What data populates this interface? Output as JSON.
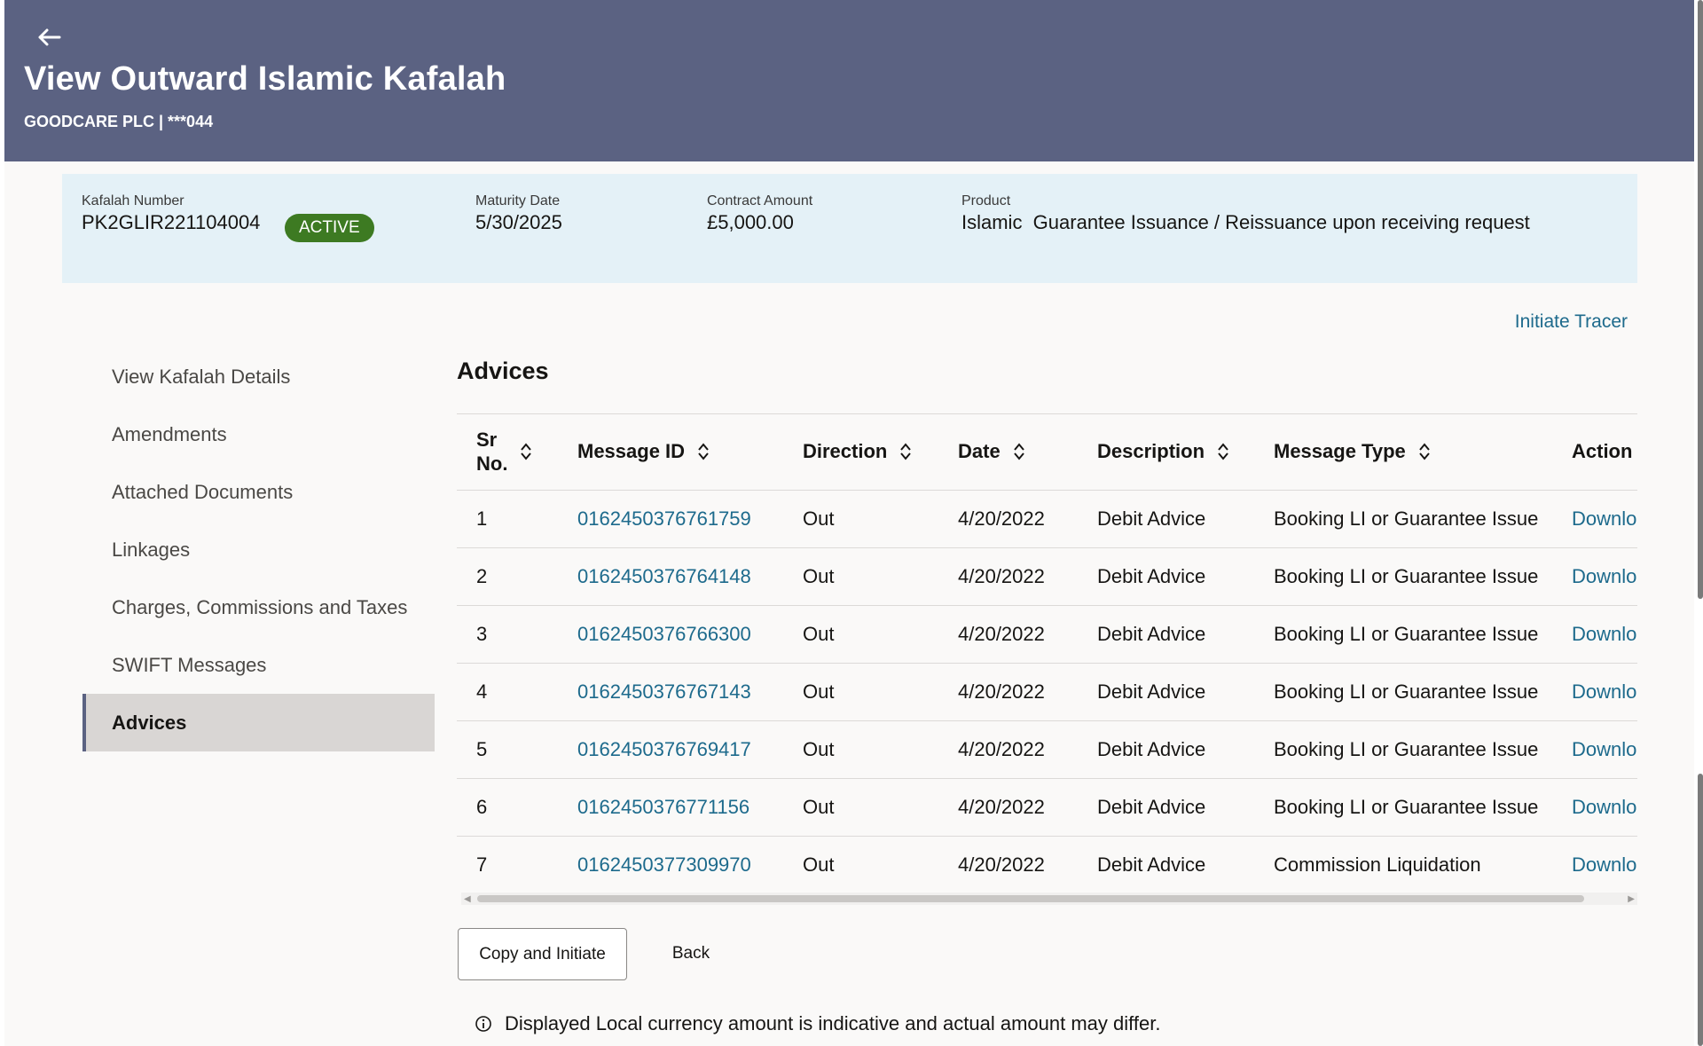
{
  "header": {
    "title": "View Outward Islamic Kafalah",
    "subtitle": "GOODCARE PLC | ***044"
  },
  "summary": {
    "kafalah_number_label": "Kafalah Number",
    "kafalah_number": "PK2GLIR221104004",
    "status": "ACTIVE",
    "maturity_label": "Maturity Date",
    "maturity_date": "5/30/2025",
    "amount_label": "Contract Amount",
    "amount": "£5,000.00",
    "product_label": "Product",
    "product": "Islamic  Guarantee Issuance / Reissuance upon receiving request"
  },
  "actions": {
    "initiate_tracer": "Initiate Tracer"
  },
  "sidebar": {
    "items": [
      {
        "label": "View Kafalah Details"
      },
      {
        "label": "Amendments"
      },
      {
        "label": "Attached Documents"
      },
      {
        "label": "Linkages"
      },
      {
        "label": "Charges, Commissions and Taxes"
      },
      {
        "label": "SWIFT Messages"
      },
      {
        "label": "Advices"
      }
    ],
    "active": "Advices"
  },
  "section": {
    "title": "Advices"
  },
  "table": {
    "headers": {
      "sr_line1": "Sr",
      "sr_line2": "No.",
      "message_id": "Message ID",
      "direction": "Direction",
      "date": "Date",
      "description": "Description",
      "message_type": "Message Type",
      "action": "Action"
    },
    "rows": [
      {
        "sr": "1",
        "message_id": "0162450376761759",
        "direction": "Out",
        "date": "4/20/2022",
        "description": "Debit Advice",
        "message_type": "Booking LI or Guarantee Issue",
        "action": "Download"
      },
      {
        "sr": "2",
        "message_id": "0162450376764148",
        "direction": "Out",
        "date": "4/20/2022",
        "description": "Debit Advice",
        "message_type": "Booking LI or Guarantee Issue",
        "action": "Download"
      },
      {
        "sr": "3",
        "message_id": "0162450376766300",
        "direction": "Out",
        "date": "4/20/2022",
        "description": "Debit Advice",
        "message_type": "Booking LI or Guarantee Issue",
        "action": "Download"
      },
      {
        "sr": "4",
        "message_id": "0162450376767143",
        "direction": "Out",
        "date": "4/20/2022",
        "description": "Debit Advice",
        "message_type": "Booking LI or Guarantee Issue",
        "action": "Download"
      },
      {
        "sr": "5",
        "message_id": "0162450376769417",
        "direction": "Out",
        "date": "4/20/2022",
        "description": "Debit Advice",
        "message_type": "Booking LI or Guarantee Issue",
        "action": "Download"
      },
      {
        "sr": "6",
        "message_id": "0162450376771156",
        "direction": "Out",
        "date": "4/20/2022",
        "description": "Debit Advice",
        "message_type": "Booking LI or Guarantee Issue",
        "action": "Download"
      },
      {
        "sr": "7",
        "message_id": "0162450377309970",
        "direction": "Out",
        "date": "4/20/2022",
        "description": "Debit Advice",
        "message_type": "Commission Liquidation",
        "action": "Download"
      }
    ]
  },
  "buttons": {
    "copy_initiate": "Copy and Initiate",
    "back": "Back"
  },
  "note": "Displayed Local currency amount is indicative and actual amount may differ.",
  "colors": {
    "header_bg": "#5b6282",
    "summary_bg": "#e4f1f7",
    "badge": "#3d7a22",
    "link": "#1d6a8c"
  }
}
